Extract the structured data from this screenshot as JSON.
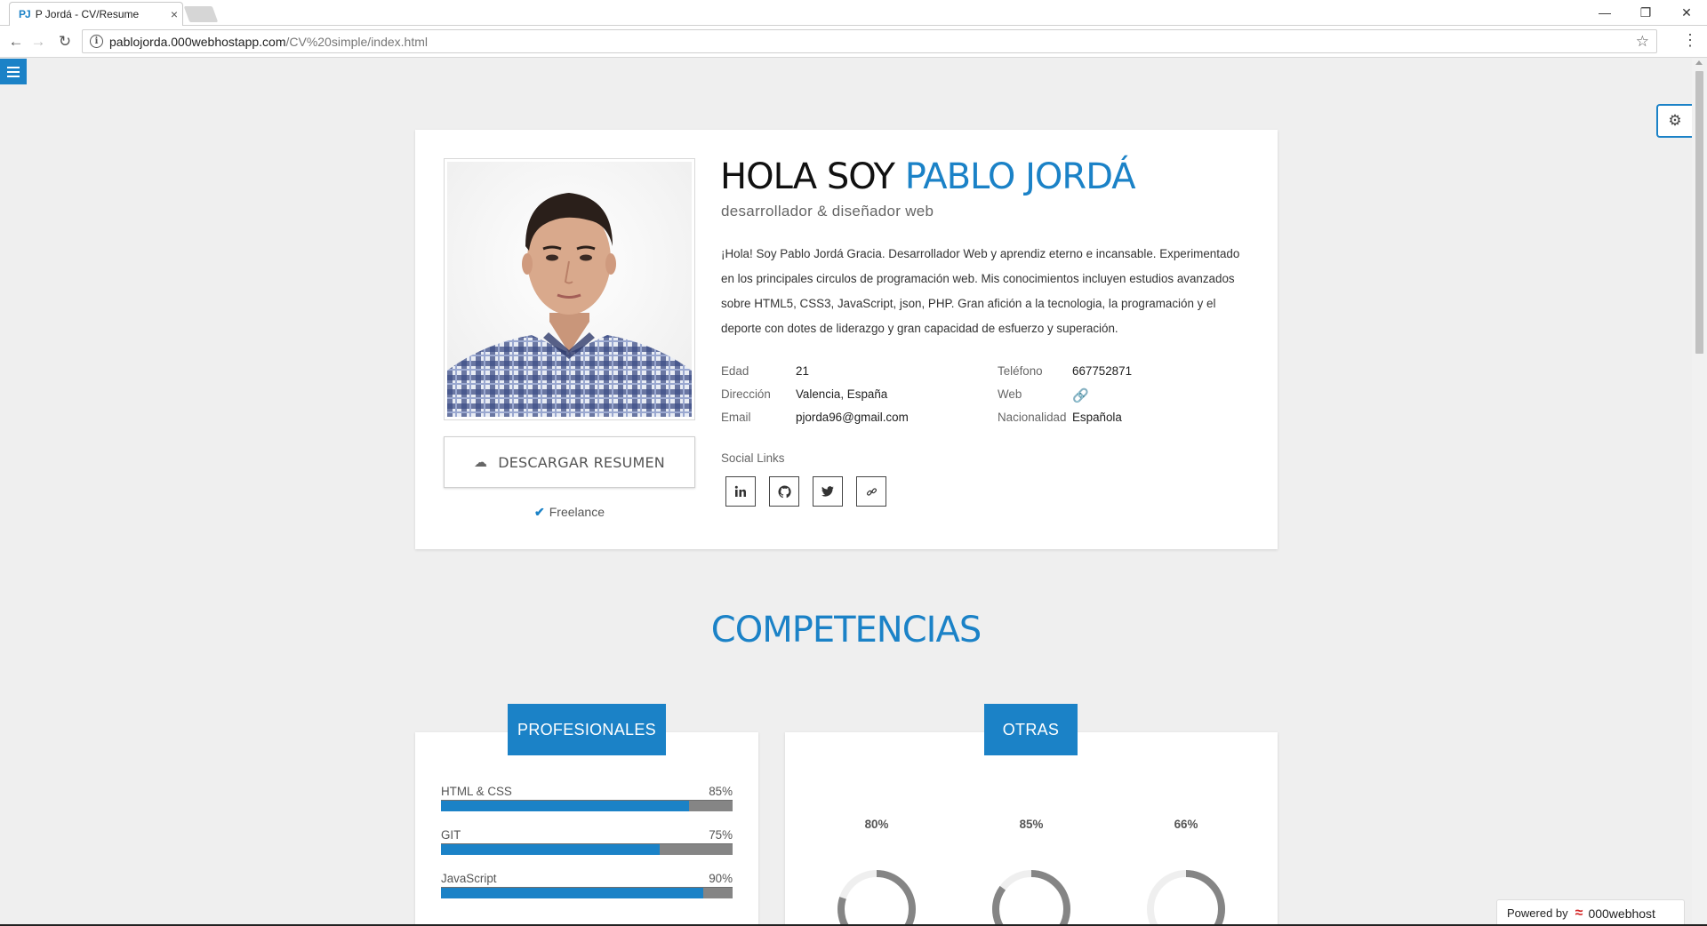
{
  "browser": {
    "tab_icon_text": "PJ",
    "tab_title": "P Jordá - CV/Resume",
    "tab_close": "×",
    "url_host": "pablojorda.000webhostapp.com",
    "url_path": "/CV%20simple/index.html",
    "window_controls": {
      "minimize": "—",
      "restore": "❐",
      "close": "✕"
    }
  },
  "profile": {
    "greeting": "HOLA SOY",
    "name": "PABLO JORDÁ",
    "role": "desarrollador & diseñador web",
    "bio": "¡Hola! Soy Pablo Jordá Gracia. Desarrollador Web y aprendiz eterno e incansable. Experimentado en los principales circulos de programación web. Mis conocimientos incluyen estudios avanzados sobre HTML5, CSS3, JavaScript, json, PHP. Gran afición a la tecnologia, la programación y el deporte con dotes de liderazgo y gran capacidad de esfuerzo y superación.",
    "download_label": "DESCARGAR RESUMEN",
    "freelance_label": "Freelance",
    "info": {
      "age_key": "Edad",
      "age_value": "21",
      "address_key": "Dirección",
      "address_value": "Valencia, España",
      "email_key": "Email",
      "email_value": "pjorda96@gmail.com",
      "phone_key": "Teléfono",
      "phone_value": "667752871",
      "web_key": "Web",
      "nationality_key": "Nacionalidad",
      "nationality_value": "Española"
    },
    "social_title": "Social Links",
    "social_icons": [
      "linkedin-icon",
      "github-icon",
      "twitter-icon",
      "link-icon"
    ]
  },
  "competencias": {
    "title": "COMPETENCIAS",
    "professional_label": "PROFESIONALES",
    "other_label": "OTRAS",
    "skills": [
      {
        "name": "HTML & CSS",
        "percent_label": "85%",
        "value": 0.85
      },
      {
        "name": "GIT",
        "percent_label": "75%",
        "value": 0.75
      },
      {
        "name": "JavaScript",
        "percent_label": "90%",
        "value": 0.9
      }
    ],
    "other_skills": [
      {
        "percent_label": "80%",
        "value": 0.8
      },
      {
        "percent_label": "85%",
        "value": 0.85
      },
      {
        "percent_label": "66%",
        "value": 0.66
      }
    ]
  },
  "footer": {
    "powered_label": "Powered by",
    "host_name": "000webhost"
  },
  "colors": {
    "accent": "#1b82c7",
    "bar_track": "#858585",
    "page_bg": "#efefef"
  }
}
